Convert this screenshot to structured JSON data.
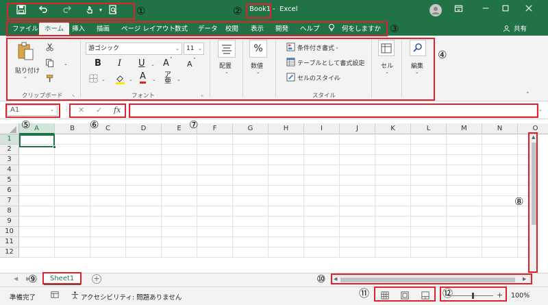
{
  "app": {
    "book_name": "Book1",
    "title_sep": "-",
    "app_name": "Excel"
  },
  "quick_access": {
    "icons": [
      "save-icon",
      "undo-icon",
      "redo-icon",
      "touch-mode-icon",
      "print-preview-icon"
    ],
    "dropdown": "▾"
  },
  "tabs": [
    {
      "label": "ファイル"
    },
    {
      "label": "ホーム",
      "active": true
    },
    {
      "label": "挿入"
    },
    {
      "label": "描画"
    },
    {
      "label": "ページ レイアウト"
    },
    {
      "label": "数式"
    },
    {
      "label": "データ"
    },
    {
      "label": "校閲"
    },
    {
      "label": "表示"
    },
    {
      "label": "開発"
    },
    {
      "label": "ヘルプ"
    }
  ],
  "tell_me": "何をしますか",
  "share": "共有",
  "ribbon": {
    "clipboard": {
      "paste": "貼り付け",
      "group": "クリップボード"
    },
    "font": {
      "name": "游ゴシック",
      "size": "11",
      "bold": "B",
      "italic": "I",
      "underline": "U",
      "grow": "A",
      "shrink": "A",
      "group": "フォント"
    },
    "alignment": {
      "label": "配置"
    },
    "number": {
      "label": "数値",
      "symbol": "%"
    },
    "styles": {
      "conditional": "条件付き書式",
      "table": "テーブルとして書式設定",
      "cell_style": "セルのスタイル",
      "group": "スタイル"
    },
    "cells": {
      "label": "セル"
    },
    "editing": {
      "label": "編集"
    }
  },
  "formula_bar": {
    "name_box": "A1",
    "fx": "fx",
    "cancel": "✕",
    "enter": "✓"
  },
  "grid": {
    "columns": [
      "A",
      "B",
      "C",
      "D",
      "E",
      "F",
      "G",
      "H",
      "I",
      "J",
      "K",
      "L",
      "M",
      "N",
      "O"
    ],
    "rows": [
      "1",
      "2",
      "3",
      "4",
      "5",
      "6",
      "7",
      "8",
      "9",
      "10",
      "11",
      "12"
    ]
  },
  "sheets": {
    "active": "Sheet1",
    "add": "+"
  },
  "status": {
    "ready": "準備完了",
    "accessibility": "アクセシビリティ: 問題ありません",
    "zoom": "100%",
    "zoom_minus": "−",
    "zoom_plus": "+",
    "zoom_level": 0.5
  },
  "annotations": [
    "①",
    "②",
    "③",
    "④",
    "⑤",
    "⑥",
    "⑦",
    "⑧",
    "⑨",
    "⑩",
    "⑪",
    "⑫"
  ],
  "colors": {
    "brand": "#217346",
    "annotation": "#e0202a"
  }
}
